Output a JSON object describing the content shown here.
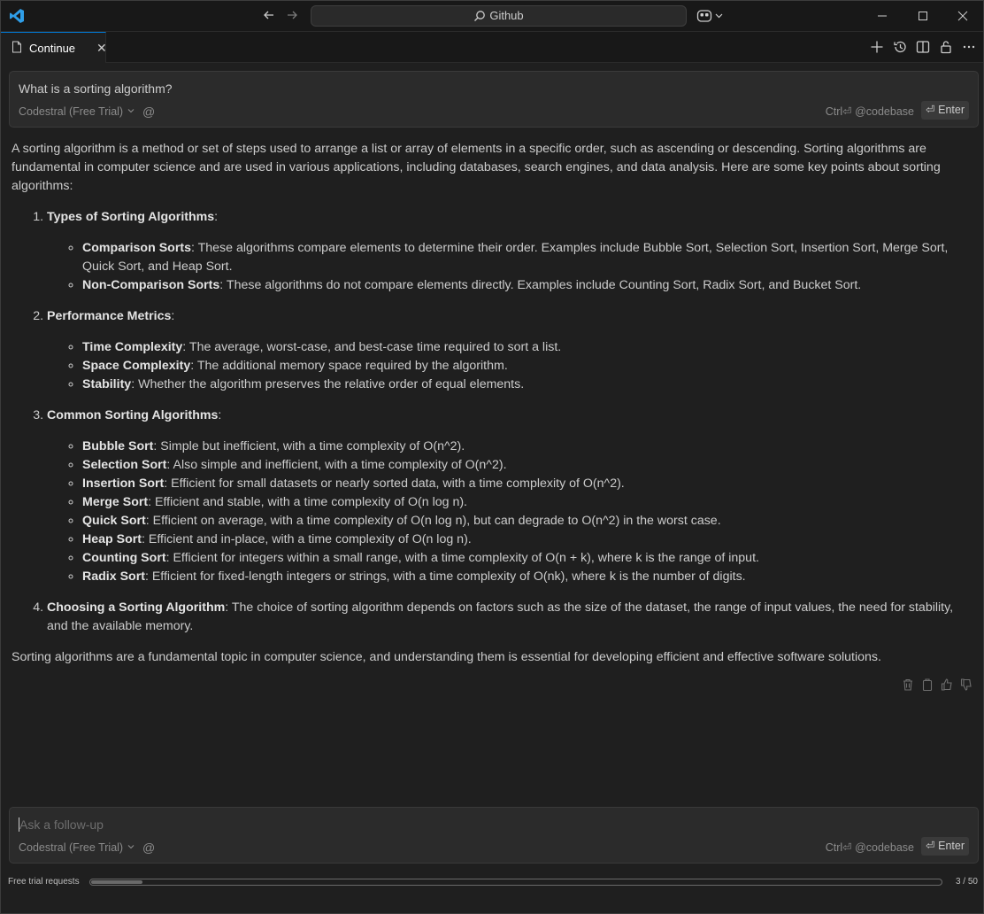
{
  "titlebar": {
    "search_label": "Github"
  },
  "tab": {
    "label": "Continue",
    "close_glyph": "✕"
  },
  "prompt": {
    "text": "What is a sorting algorithm?",
    "model": "Codestral (Free Trial)",
    "at_glyph": "@",
    "hint": "Ctrl⏎ @codebase",
    "enter_label": "⏎ Enter"
  },
  "response": {
    "intro": "A sorting algorithm is a method or set of steps used to arrange a list or array of elements in a specific order, such as ascending or descending. Sorting algorithms are fundamental in computer science and are used in various applications, including databases, search engines, and data analysis. Here are some key points about sorting algorithms:",
    "sections": [
      {
        "title": "Types of Sorting Algorithms",
        "items": [
          {
            "term": "Comparison Sorts",
            "text": ": These algorithms compare elements to determine their order. Examples include Bubble Sort, Selection Sort, Insertion Sort, Merge Sort, Quick Sort, and Heap Sort."
          },
          {
            "term": "Non-Comparison Sorts",
            "text": ": These algorithms do not compare elements directly. Examples include Counting Sort, Radix Sort, and Bucket Sort."
          }
        ]
      },
      {
        "title": "Performance Metrics",
        "items": [
          {
            "term": "Time Complexity",
            "text": ": The average, worst-case, and best-case time required to sort a list."
          },
          {
            "term": "Space Complexity",
            "text": ": The additional memory space required by the algorithm."
          },
          {
            "term": "Stability",
            "text": ": Whether the algorithm preserves the relative order of equal elements."
          }
        ]
      },
      {
        "title": "Common Sorting Algorithms",
        "items": [
          {
            "term": "Bubble Sort",
            "text": ": Simple but inefficient, with a time complexity of O(n^2)."
          },
          {
            "term": "Selection Sort",
            "text": ": Also simple and inefficient, with a time complexity of O(n^2)."
          },
          {
            "term": "Insertion Sort",
            "text": ": Efficient for small datasets or nearly sorted data, with a time complexity of O(n^2)."
          },
          {
            "term": "Merge Sort",
            "text": ": Efficient and stable, with a time complexity of O(n log n)."
          },
          {
            "term": "Quick Sort",
            "text": ": Efficient on average, with a time complexity of O(n log n), but can degrade to O(n^2) in the worst case."
          },
          {
            "term": "Heap Sort",
            "text": ": Efficient and in-place, with a time complexity of O(n log n)."
          },
          {
            "term": "Counting Sort",
            "text": ": Efficient for integers within a small range, with a time complexity of O(n + k), where k is the range of input."
          },
          {
            "term": "Radix Sort",
            "text": ": Efficient for fixed-length integers or strings, with a time complexity of O(nk), where k is the number of digits."
          }
        ]
      },
      {
        "title": "Choosing a Sorting Algorithm",
        "text": ": The choice of sorting algorithm depends on factors such as the size of the dataset, the range of input values, the need for stability, and the available memory."
      }
    ],
    "conclusion": "Sorting algorithms are a fundamental topic in computer science, and understanding them is essential for developing efficient and effective software solutions."
  },
  "followup": {
    "placeholder": "Ask a follow-up",
    "model": "Codestral (Free Trial)",
    "at_glyph": "@",
    "hint": "Ctrl⏎ @codebase",
    "enter_label": "⏎ Enter"
  },
  "status": {
    "label": "Free trial requests",
    "count": "3 / 50",
    "used": 3,
    "total": 50
  },
  "icons": {
    "logo": "vscode-logo-icon",
    "accent": "#0078d4"
  }
}
